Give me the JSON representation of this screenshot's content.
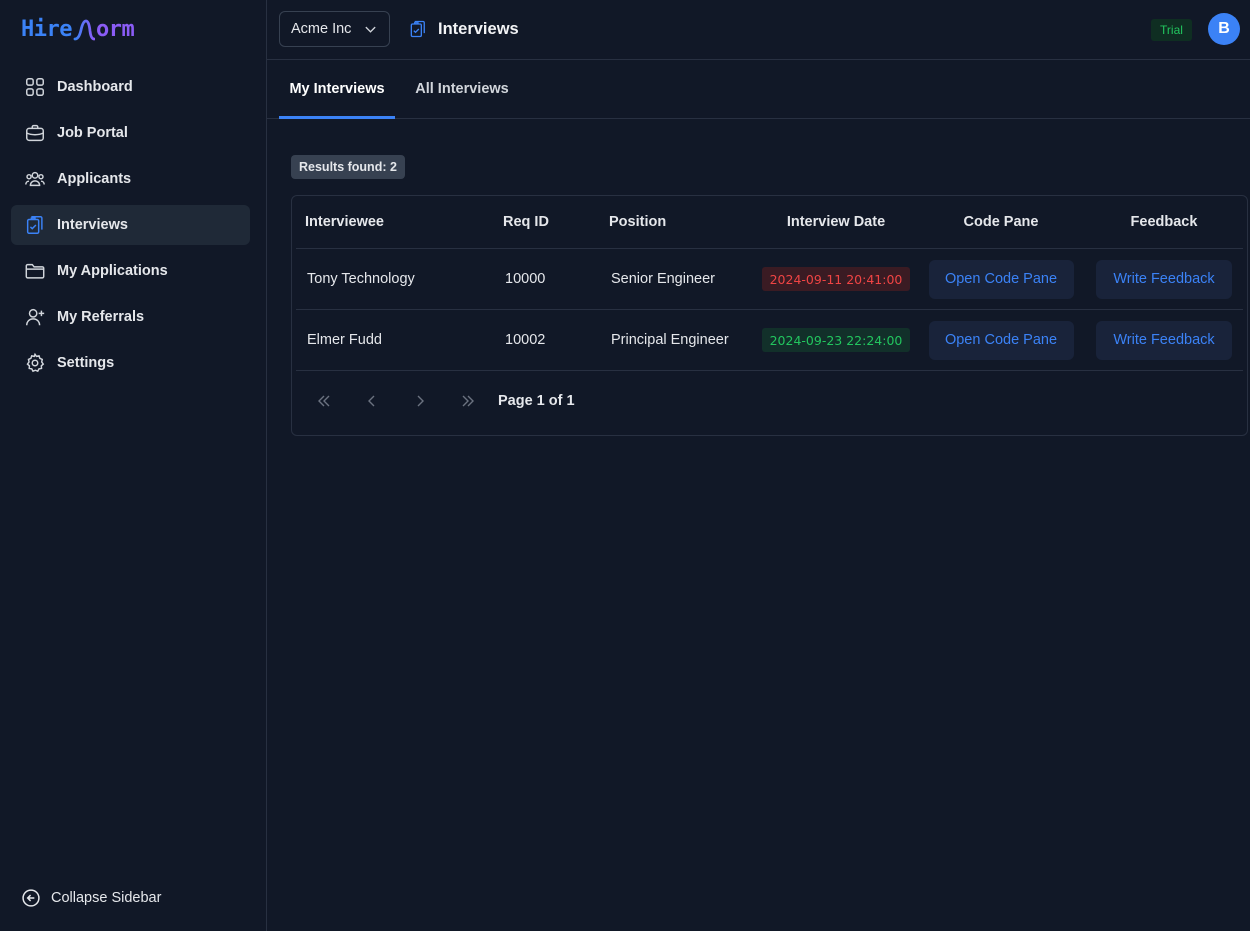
{
  "brand": {
    "part1": "Hire",
    "part2": "orm"
  },
  "sidebar": {
    "items": [
      {
        "label": "Dashboard",
        "icon": "grid-icon"
      },
      {
        "label": "Job Portal",
        "icon": "briefcase-icon"
      },
      {
        "label": "Applicants",
        "icon": "users-icon"
      },
      {
        "label": "Interviews",
        "icon": "clipboard-check-icon",
        "active": true
      },
      {
        "label": "My Applications",
        "icon": "folder-icon"
      },
      {
        "label": "My Referrals",
        "icon": "user-plus-icon"
      },
      {
        "label": "Settings",
        "icon": "gear-icon"
      }
    ],
    "collapse_label": "Collapse Sidebar"
  },
  "header": {
    "org": "Acme Inc",
    "title": "Interviews",
    "trial_badge": "Trial",
    "avatar_initial": "B"
  },
  "tabs": [
    {
      "label": "My Interviews",
      "active": true
    },
    {
      "label": "All Interviews",
      "active": false
    }
  ],
  "results_label": "Results found: 2",
  "table": {
    "columns": [
      "Interviewee",
      "Req ID",
      "Position",
      "Interview Date",
      "Code Pane",
      "Feedback"
    ],
    "rows": [
      {
        "interviewee": "Tony Technology",
        "req_id": "10000",
        "position": "Senior Engineer",
        "date": "2024-09-11 20:41:00",
        "date_status": "past",
        "code_action": "Open Code Pane",
        "feedback_action": "Write Feedback"
      },
      {
        "interviewee": "Elmer Fudd",
        "req_id": "10002",
        "position": "Principal Engineer",
        "date": "2024-09-23 22:24:00",
        "date_status": "upcoming",
        "code_action": "Open Code Pane",
        "feedback_action": "Write Feedback"
      }
    ]
  },
  "pagination": {
    "label": "Page 1 of 1"
  },
  "colors": {
    "accent": "#3b82f6",
    "past": "#ef4444",
    "upcoming": "#22c55e",
    "background": "#111827"
  }
}
